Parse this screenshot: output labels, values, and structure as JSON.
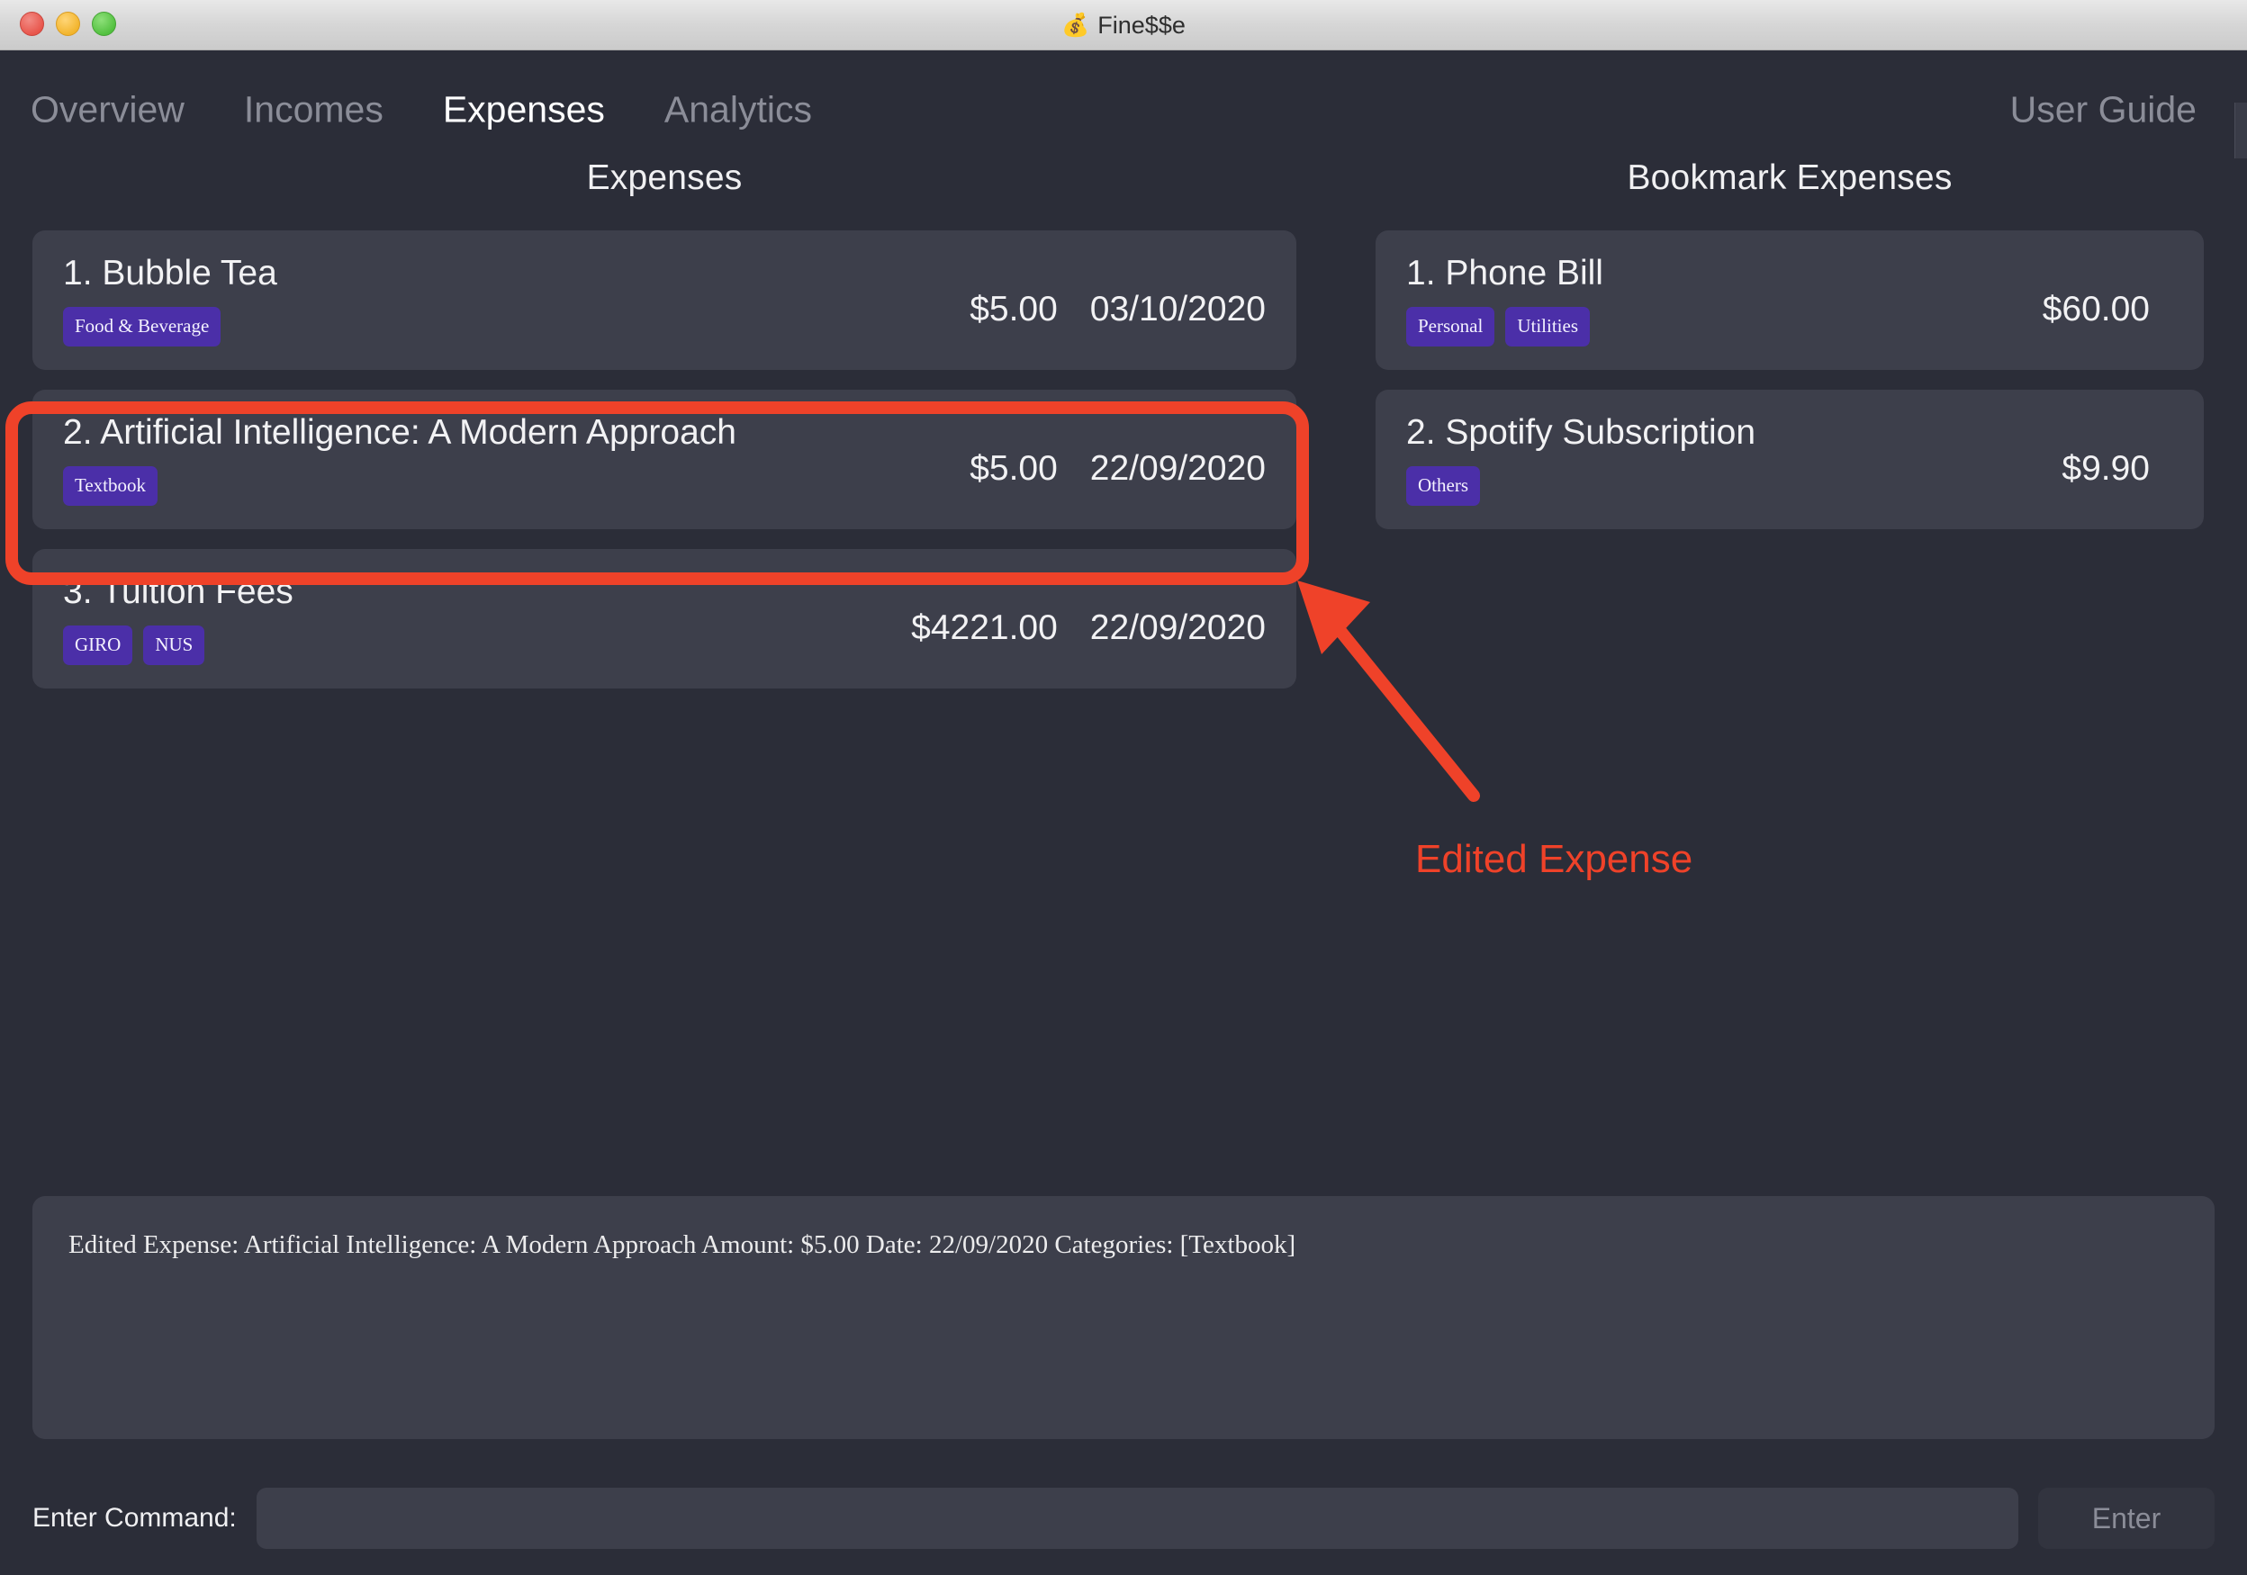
{
  "window": {
    "title": "Fine$$e",
    "icon": "money-bag-icon",
    "traffic_lights": [
      "close",
      "minimize",
      "zoom"
    ]
  },
  "nav": {
    "tabs": [
      {
        "label": "Overview",
        "active": false
      },
      {
        "label": "Incomes",
        "active": false
      },
      {
        "label": "Expenses",
        "active": true
      },
      {
        "label": "Analytics",
        "active": false
      }
    ],
    "user_guide_label": "User Guide"
  },
  "expenses_panel": {
    "heading": "Expenses",
    "items": [
      {
        "title": "1. Bubble Tea",
        "tags": [
          "Food & Beverage"
        ],
        "amount": "$5.00",
        "date": "03/10/2020",
        "highlighted": false
      },
      {
        "title": "2. Artificial Intelligence: A Modern Approach",
        "tags": [
          "Textbook"
        ],
        "amount": "$5.00",
        "date": "22/09/2020",
        "highlighted": true
      },
      {
        "title": "3. Tuition Fees",
        "tags": [
          "GIRO",
          "NUS"
        ],
        "amount": "$4221.00",
        "date": "22/09/2020",
        "highlighted": false
      }
    ]
  },
  "bookmark_panel": {
    "heading": "Bookmark Expenses",
    "items": [
      {
        "title": "1. Phone Bill",
        "tags": [
          "Personal",
          "Utilities"
        ],
        "amount": "$60.00",
        "date": ""
      },
      {
        "title": "2. Spotify Subscription",
        "tags": [
          "Others"
        ],
        "amount": "$9.90",
        "date": ""
      }
    ]
  },
  "result_panel": {
    "text": "Edited Expense: Artificial Intelligence: A Modern Approach Amount: $5.00 Date: 22/09/2020 Categories: [Textbook]"
  },
  "command_bar": {
    "label": "Enter Command:",
    "input_value": "",
    "input_placeholder": "",
    "enter_label": "Enter"
  },
  "annotation": {
    "label": "Edited Expense",
    "color": "#ef4229",
    "target": "expense-item-2"
  },
  "colors": {
    "app_background": "#2b2d38",
    "card_background": "#3d3f4b",
    "tag_purple": "#4b2fa8",
    "text_primary": "#f2f2f4",
    "text_muted": "#8b8d98",
    "annotation_red": "#ef4229"
  }
}
